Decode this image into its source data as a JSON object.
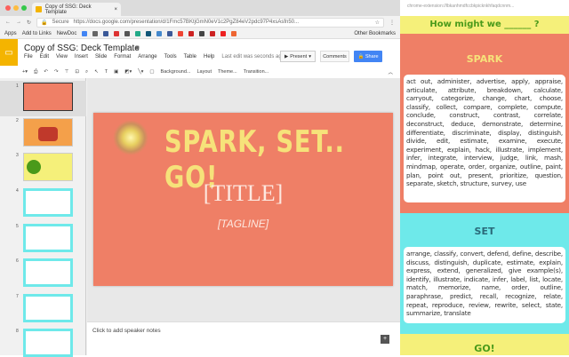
{
  "browser": {
    "tab_title": "Copy of SSG: Deck Template",
    "secure_label": "Secure",
    "url": "https://docs.google.com/presentation/d/1Fmc57BKtjGmN0eV1c2PgZ84eV2pdc97P4xsAsfn50...",
    "bookmarks": [
      "Apps",
      "Add to Links",
      "NewDoc"
    ],
    "other_bookmarks": "Other Bookmarks"
  },
  "docs": {
    "title": "Copy of SSG: Deck Template",
    "menu": [
      "File",
      "Edit",
      "View",
      "Insert",
      "Slide",
      "Format",
      "Arrange",
      "Tools",
      "Table",
      "Help"
    ],
    "last_edit": "Last edit was seconds ago",
    "present": "Present",
    "comments": "Comments",
    "share": "Share",
    "toolbar": {
      "background": "Background...",
      "layout": "Layout",
      "theme": "Theme...",
      "transition": "Transition..."
    }
  },
  "filmstrip": {
    "numbers": [
      "1",
      "2",
      "3",
      "4",
      "5",
      "6",
      "7",
      "8"
    ]
  },
  "slide": {
    "heading": "SPARK, SET.. GO!",
    "title": "[TITLE]",
    "tagline": "[TAGLINE]"
  },
  "notes": {
    "placeholder": "Click to add speaker notes"
  },
  "panel": {
    "url": "chrome-extension://lbkanhmdfccbkpicknkhfaqdcnnm...",
    "prompt": "How might we ______ ?",
    "spark": {
      "label": "SPARK",
      "words": "act out, administer, advertise, apply, appraise, articulate, attribute, breakdown, calculate, carryout, categorize, change, chart, choose, classify, collect, compare, complete, compute, conclude, construct, contrast, correlate, deconstruct, deduce, demonstrate, determine, differentiate, discriminate, display, distinguish, divide, edit, estimate, examine, execute, experiment, explain, hack, illustrate, implement, infer, integrate, interview, judge, link, mash, mindmap, operate, order, organize, outline, paint, plan, point out, present, prioritize, question, separate, sketch, structure, survey, use"
    },
    "set": {
      "label": "SET",
      "words": "arrange, classify, convert, defend, define, describe, discuss, distinguish, duplicate, estimate, explain, express, extend, generalized, give example(s), identify, illustrate, indicate, infer, label, list, locate, match, memorize, name, order, outline, paraphrase, predict, recall, recognize, relate, repeat, reproduce, review, rewrite, select, state, summarize, translate"
    },
    "go": {
      "label": "GO!"
    }
  },
  "colors": {
    "slide": "#ef7f66",
    "set": "#6ee9ea",
    "yellow": "#f5f07a",
    "share": "#4285f4"
  }
}
